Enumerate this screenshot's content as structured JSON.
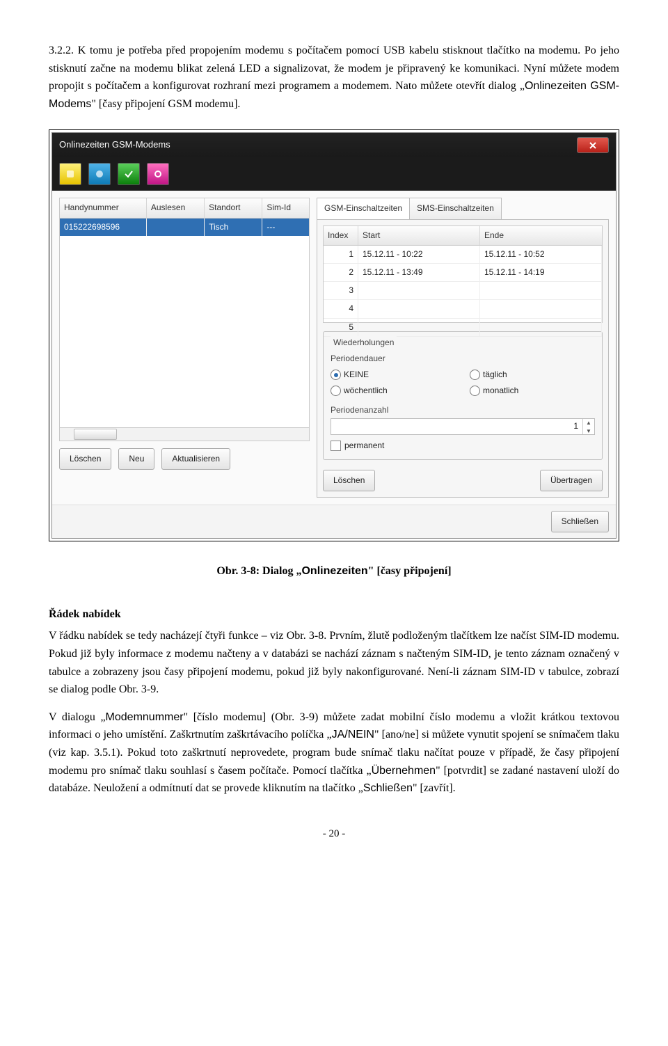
{
  "para1": "3.2.2. K tomu je potřeba před propojením modemu s počítačem pomocí USB kabelu stisknout tlačítko na modemu. Po jeho stisknutí začne na modemu blikat zelená LED a signalizovat, že modem je připravený ke komunikaci. Nyní můžete modem propojit s počítačem a konfigurovat rozhraní mezi programem a modemem. Nato můžete otevřít dialog „",
  "para1_code": "Onlinezeiten GSM-Modems",
  "para1_tail": "\" [časy připojení GSM modemu].",
  "dlg": {
    "title": "Onlinezeiten GSM-Modems",
    "left_cols": [
      "Handynummer",
      "Auslesen",
      "Standort",
      "Sim-Id"
    ],
    "left_row": {
      "handynummer": "015222698596",
      "auslesen": "",
      "standort": "Tisch",
      "simid": "---"
    },
    "left_btns": [
      "Löschen",
      "Neu",
      "Aktualisieren"
    ],
    "tabs": [
      "GSM-Einschaltzeiten",
      "SMS-Einschaltzeiten"
    ],
    "times_cols": [
      "Index",
      "Start",
      "Ende"
    ],
    "times_rows": [
      {
        "i": "1",
        "s": "15.12.11 - 10:22",
        "e": "15.12.11 - 10:52"
      },
      {
        "i": "2",
        "s": "15.12.11 - 13:49",
        "e": "15.12.11 - 14:19"
      },
      {
        "i": "3",
        "s": "",
        "e": ""
      },
      {
        "i": "4",
        "s": "",
        "e": ""
      },
      {
        "i": "5",
        "s": "",
        "e": ""
      }
    ],
    "wieder": "Wiederholungen",
    "period": "Periodendauer",
    "radios": [
      "KEINE",
      "täglich",
      "wöchentlich",
      "monatlich"
    ],
    "periodn": "Periodenanzahl",
    "periodn_val": "1",
    "perm": "permanent",
    "right_btns": [
      "Löschen",
      "Übertragen"
    ],
    "footer_btn": "Schließen"
  },
  "caption": "Obr. 3-8: Dialog „",
  "caption_code": "Onlinezeiten",
  "caption_tail": "\" [časy připojení]",
  "heading": "Řádek nabídek",
  "para2": "V řádku nabídek se tedy nacházejí čtyři funkce – viz Obr. 3-8. Prvním, žlutě podloženým tlačítkem lze načíst SIM-ID modemu. Pokud již byly informace z modemu načteny a v databázi se nachází záznam s načteným SIM-ID, je tento záznam označený v tabulce a zobrazeny jsou časy připojení modemu, pokud již byly nakonfigurované. Není-li záznam SIM-ID v tabulce, zobrazí se dialog podle Obr. 3-9.",
  "para3a": "V dialogu „",
  "para3a_code": "Modemnummer",
  "para3a_tail": "\" [číslo modemu] (Obr. 3-9) můžete zadat mobilní číslo modemu a vložit krátkou textovou informaci o jeho umístění. Zaškrtnutím zaškrtávacího políčka „",
  "para3b_code": "JA/NEIN",
  "para3b_tail": "\" [ano/ne] si můžete vynutit spojení se snímačem tlaku (viz kap. 3.5.1). Pokud toto zaškrtnutí neprovedete, program bude snímač tlaku načítat pouze v případě, že časy připojení modemu pro snímač tlaku souhlasí s časem počítače. Pomocí tlačítka „",
  "para3c_code": "Übernehmen",
  "para3c_tail": "\" [potvrdit] se zadané nastavení uloží do databáze. Neuložení a odmítnutí dat se provede kliknutím na tlačítko „",
  "para3d_code": "Schließen",
  "para3d_tail": "\" [zavřít].",
  "page": "- 20 -"
}
